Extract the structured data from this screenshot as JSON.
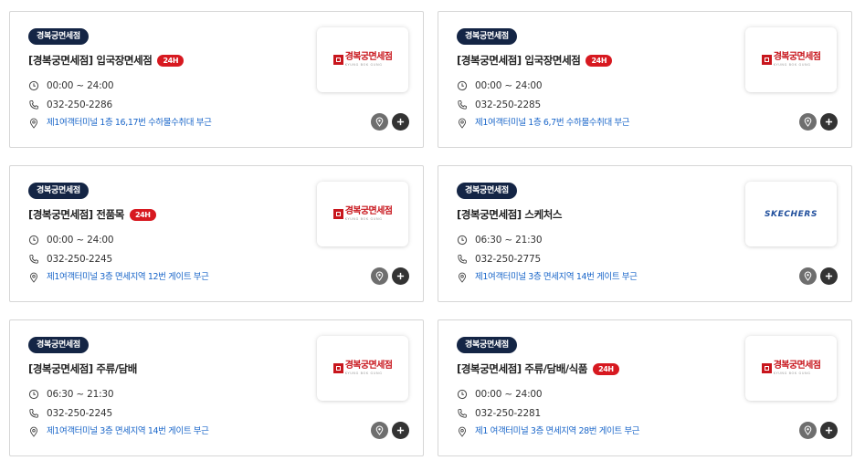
{
  "stores": [
    {
      "badge": "경복궁면세점",
      "title": "[경복궁면세점] 입국장면세점",
      "tag": "24H",
      "hours": "00:00 ~ 24:00",
      "phone": "032-250-2286",
      "location": "제1여객터미널 1층 16,17번 수하물수취대 부근",
      "logo": "gyeongbokgung-logo"
    },
    {
      "badge": "경복궁면세점",
      "title": "[경복궁면세점] 입국장면세점",
      "tag": "24H",
      "hours": "00:00 ~ 24:00",
      "phone": "032-250-2285",
      "location": "제1여객터미널 1층 6,7번 수하물수취대 부근",
      "logo": "gyeongbokgung-logo"
    },
    {
      "badge": "경복궁면세점",
      "title": "[경복궁면세점] 전품목",
      "tag": "24H",
      "hours": "00:00 ~ 24:00",
      "phone": "032-250-2245",
      "location": "제1여객터미널 3층 면세지역 12번 게이트 부근",
      "logo": "gyeongbokgung-logo"
    },
    {
      "badge": "경복궁면세점",
      "title": "[경복궁면세점] 스케처스",
      "tag": "",
      "hours": "06:30 ~ 21:30",
      "phone": "032-250-2775",
      "location": "제1여객터미널 3층 면세지역 14번 게이트 부근",
      "logo": "skechers-logo"
    },
    {
      "badge": "경복궁면세점",
      "title": "[경복궁면세점] 주류/담배",
      "tag": "",
      "hours": "06:30 ~ 21:30",
      "phone": "032-250-2245",
      "location": "제1여객터미널 3층 면세지역 14번 게이트 부근",
      "logo": "gyeongbokgung-logo"
    },
    {
      "badge": "경복궁면세점",
      "title": "[경복궁면세점] 주류/담배/식품",
      "tag": "24H",
      "hours": "00:00 ~ 24:00",
      "phone": "032-250-2281",
      "location": "제1 여객터미널 3층 면세지역 28번 게이트 부근",
      "logo": "gyeongbokgung-logo"
    }
  ],
  "logos": {
    "gyeongbokgung": {
      "korean": "경복궁면세점",
      "english": "KYUNG BOK GUNG",
      "color": "#c8161d"
    },
    "skechers": {
      "text": "SKECHERS",
      "color": "#1f4e9c"
    }
  },
  "colors": {
    "badge": "#142545",
    "tag": "#d71920",
    "location_link": "#1a66c9",
    "map_button": "#6e6e6e",
    "add_button": "#333333"
  },
  "icons": {
    "hours": "clock-icon",
    "phone": "phone-icon",
    "location": "location-pin-icon",
    "map": "map-pin-icon",
    "add": "plus-icon"
  }
}
